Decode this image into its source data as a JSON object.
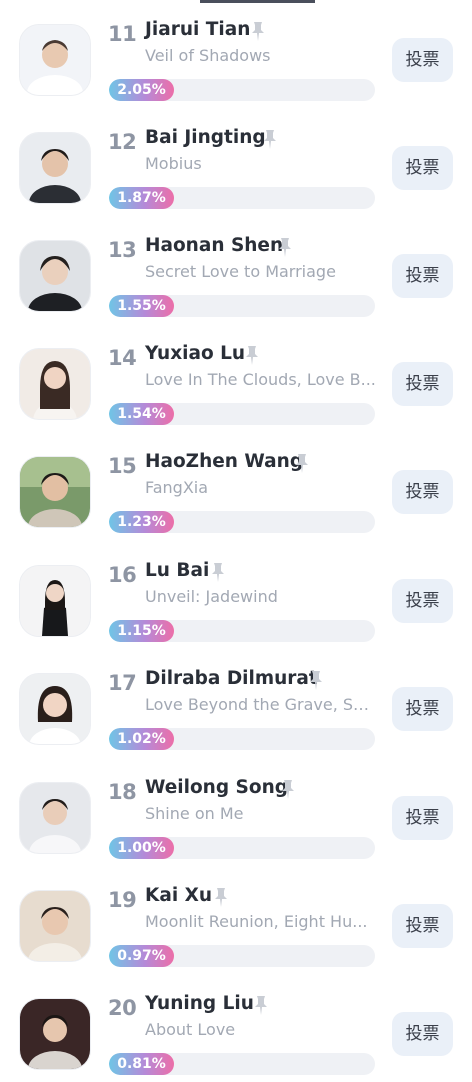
{
  "vote_label": "投票",
  "colors": {
    "rank": "#8e95a3",
    "name": "#2a2f38",
    "works": "#a2a8b3",
    "bar_gradient": [
      "#6fc5e6",
      "#b58ad8",
      "#ec6ea8"
    ],
    "button_bg": "#eaf0f8"
  },
  "entries": [
    {
      "rank": "11",
      "name": "Jiarui Tian",
      "works": "Veil of Shadows",
      "percent": "2.05%",
      "share": 0.0205,
      "vote_label": "投票"
    },
    {
      "rank": "12",
      "name": "Bai Jingting",
      "works": "Mobius",
      "percent": "1.87%",
      "share": 0.0187,
      "vote_label": "投票"
    },
    {
      "rank": "13",
      "name": "Haonan Shen",
      "works": "Secret Love to Marriage",
      "percent": "1.55%",
      "share": 0.0155,
      "vote_label": "投票"
    },
    {
      "rank": "14",
      "name": "Yuxiao Lu",
      "works": "Love In The Clouds, Love B...",
      "percent": "1.54%",
      "share": 0.0154,
      "vote_label": "投票"
    },
    {
      "rank": "15",
      "name": "HaoZhen Wang",
      "works": "FangXia",
      "percent": "1.23%",
      "share": 0.0123,
      "vote_label": "投票"
    },
    {
      "rank": "16",
      "name": "Lu Bai",
      "works": "Unveil: Jadewind",
      "percent": "1.15%",
      "share": 0.0115,
      "vote_label": "投票"
    },
    {
      "rank": "17",
      "name": "Dilraba Dilmurat",
      "works": "Love Beyond the Grave, Sw...",
      "percent": "1.02%",
      "share": 0.0102,
      "vote_label": "投票"
    },
    {
      "rank": "18",
      "name": "Weilong Song",
      "works": "Shine on Me",
      "percent": "1.00%",
      "share": 0.01,
      "vote_label": "投票"
    },
    {
      "rank": "19",
      "name": "Kai Xu",
      "works": "Moonlit Reunion, Eight Hu...",
      "percent": "0.97%",
      "share": 0.0097,
      "vote_label": "投票"
    },
    {
      "rank": "20",
      "name": "Yuning Liu",
      "works": "About Love",
      "percent": "0.81%",
      "share": 0.0081,
      "vote_label": "投票"
    }
  ]
}
